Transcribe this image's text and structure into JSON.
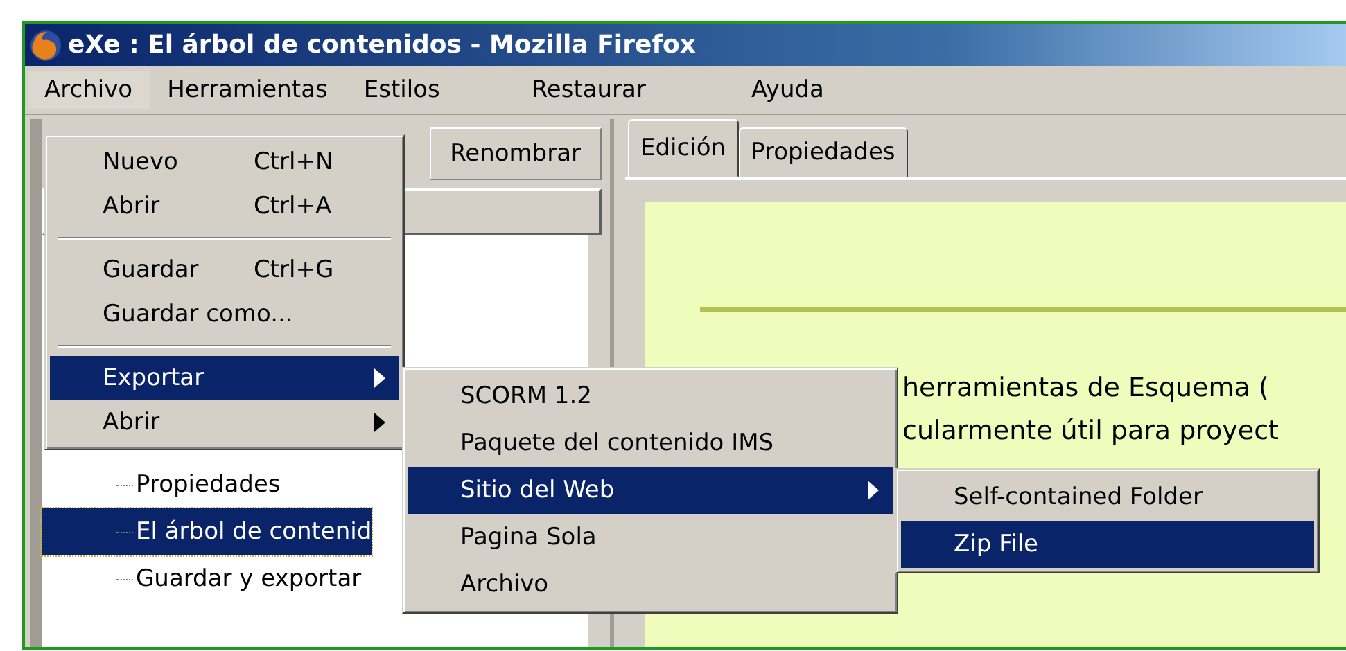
{
  "window": {
    "title": "eXe : El árbol de contenidos - Mozilla Firefox"
  },
  "menu_bar": [
    {
      "label": "Archivo",
      "selected": true
    },
    {
      "label": "Herramientas",
      "selected": false
    },
    {
      "label": "Estilos",
      "selected": false
    },
    {
      "label": "Restaurar",
      "selected": false
    },
    {
      "label": "Ayuda",
      "selected": false
    }
  ],
  "outline_pane": {
    "toolbar_button": "Renombrar",
    "tree": [
      {
        "label": "Propiedades",
        "selected": false
      },
      {
        "label": "El árbol de contenid",
        "selected": true
      },
      {
        "label": "Guardar y exportar",
        "selected": false
      }
    ]
  },
  "tabs": [
    {
      "label": "Edición",
      "selected": true
    },
    {
      "label": "Propiedades",
      "selected": false
    }
  ],
  "content": {
    "lines": [
      "herramientas de Esquema (",
      "cularmente útil para proyect"
    ]
  },
  "file_menu": [
    {
      "kind": "item",
      "label": "Nuevo",
      "shortcut": "Ctrl+N",
      "selected": false
    },
    {
      "kind": "item",
      "label": "Abrir",
      "shortcut": "Ctrl+A",
      "selected": false
    },
    {
      "kind": "separator"
    },
    {
      "kind": "item",
      "label": "Guardar",
      "shortcut": "Ctrl+G",
      "selected": false
    },
    {
      "kind": "item",
      "label": "Guardar como...",
      "selected": false
    },
    {
      "kind": "separator"
    },
    {
      "kind": "submenu",
      "label": "Exportar",
      "selected": true
    },
    {
      "kind": "submenu",
      "label": "Abrir",
      "selected": false
    }
  ],
  "export_menu": [
    {
      "kind": "item",
      "label": "SCORM 1.2",
      "selected": false
    },
    {
      "kind": "item",
      "label": "Paquete del contenido IMS",
      "selected": false
    },
    {
      "kind": "submenu",
      "label": "Sitio del Web",
      "selected": true
    },
    {
      "kind": "item",
      "label": "Pagina Sola",
      "selected": false
    },
    {
      "kind": "item",
      "label": "Archivo",
      "selected": false
    }
  ],
  "web_menu": [
    {
      "kind": "item",
      "label": "Self-contained Folder",
      "selected": false
    },
    {
      "kind": "item",
      "label": "Zip File",
      "selected": true
    }
  ]
}
